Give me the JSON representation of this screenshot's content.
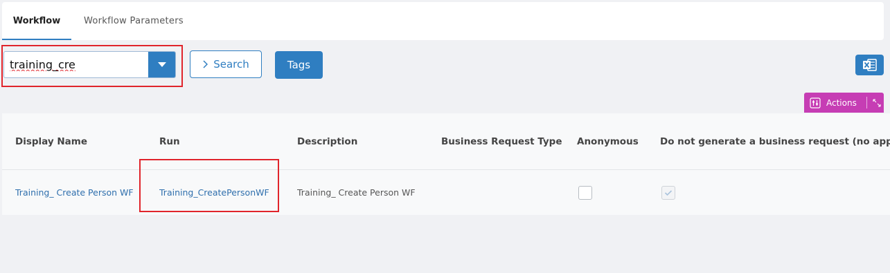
{
  "tabs": [
    {
      "label": "Workflow",
      "active": true
    },
    {
      "label": "Workflow Parameters",
      "active": false
    }
  ],
  "search": {
    "value": "training_cre",
    "button_label": "Search",
    "tags_label": "Tags"
  },
  "toolbar": {
    "export_icon": "excel-icon",
    "actions_label": "Actions"
  },
  "grid": {
    "columns": [
      "Display Name",
      "Run",
      "Description",
      "Business Request Type",
      "Anonymous",
      "Do not generate a business request (no approva"
    ],
    "rows": [
      {
        "display_name": "Training_ Create Person WF",
        "run": "Training_CreatePersonWF",
        "description": "Training_ Create Person WF",
        "business_request_type": "",
        "anonymous": false,
        "no_business_request": true
      }
    ]
  },
  "colors": {
    "primary": "#2f7ec1",
    "actions": "#c63db4",
    "highlight": "#e0242b"
  }
}
